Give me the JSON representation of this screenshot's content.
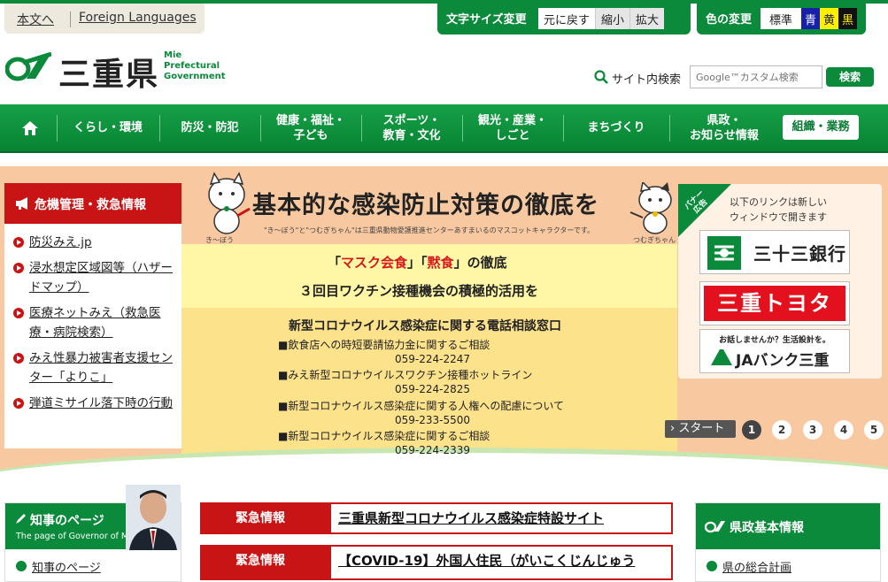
{
  "skip_links": {
    "main_text": "本文へ",
    "foreign": "Foreign Languages"
  },
  "font_size": {
    "label": "文字サイズ変更",
    "reset": "元に戻す",
    "smaller": "縮小",
    "larger": "拡大"
  },
  "color_change": {
    "label": "色の変更",
    "standard": "標準",
    "blue": "青",
    "yellow": "黄",
    "black": "黒"
  },
  "logo": {
    "kanji": "三重県",
    "en_line1": "Mie",
    "en_line2": "Prefectural",
    "en_line3": "Government"
  },
  "search": {
    "label": "サイト内検索",
    "placeholder": "Google™カスタム検索",
    "button": "検索"
  },
  "nav": {
    "home_icon": "home-icon",
    "items": [
      {
        "label": "くらし・環境"
      },
      {
        "label": "防災・防犯"
      },
      {
        "label": "健康・福祉・\n子ども"
      },
      {
        "label": "スポーツ・\n教育・文化"
      },
      {
        "label": "観光・産業・\nしごと"
      },
      {
        "label": "まちづくり"
      },
      {
        "label": "県政・\nお知らせ情報"
      }
    ],
    "special": "組織・業務"
  },
  "hero": {
    "title": "基本的な感染防止対策の徹底を",
    "note": "\"き～ぼう\"と\"つむぎちゃん\"は三重県動物愛護推進センターあすまいるのマスコットキャラクターです。",
    "char1": "き～ぼう",
    "char2": "つむぎちゃん",
    "line1_a": "「",
    "line1_red1": "マスク会食",
    "line1_b": "」「",
    "line1_red2": "黙食",
    "line1_c": "」の徹底",
    "line2": "３回目ワクチン接種機会の積極的活用を",
    "phone_title": "新型コロナウイルス感染症に関する電話相談窓口",
    "phones": [
      {
        "label": "■飲食店への時短要請協力金に関するご相談",
        "number": "059-224-2247"
      },
      {
        "label": "■みえ新型コロナウイルスワクチン接種ホットライン",
        "number": "059-224-2825"
      },
      {
        "label": "■新型コロナウイルス感染症に関する人権への配慮について",
        "number": "059-233-5500"
      },
      {
        "label": "■新型コロナウイルス感染症に関するご相談",
        "number": "059-224-2339"
      }
    ],
    "slider": {
      "start": "スタート",
      "pages": [
        "1",
        "2",
        "3",
        "4",
        "5"
      ],
      "active": "1"
    }
  },
  "crisis": {
    "title": "危機管理・救急情報",
    "items": [
      {
        "label": "防災みえ.jp"
      },
      {
        "label": "浸水想定区域図等（ハザードマップ）"
      },
      {
        "label": "医療ネットみえ（救急医療・病院検索）"
      },
      {
        "label": "みえ性暴力被害者支援センター「よりこ」"
      },
      {
        "label": "弾道ミサイル落下時の行動"
      }
    ]
  },
  "ads": {
    "corner": "バナー\n広告",
    "note_line1": "以下のリンクは新しい",
    "note_line2": "ウィンドウで開きます",
    "bank1": "三十三銀行",
    "toyota": "三重トヨタ",
    "ja_top": "お話しませんか？生活設計を。",
    "ja_name": "JAバンク三重"
  },
  "governor": {
    "title": "知事のページ",
    "subtitle": "The page of Governor of Mie",
    "link": "知事のページ"
  },
  "emergency": [
    {
      "tag": "緊急情報",
      "text": "三重県新型コロナウイルス感染症特設サイト"
    },
    {
      "tag": "緊急情報",
      "text": "【COVID-19】外国人住民（がいこくじんじゅう"
    }
  ],
  "basic_info": {
    "title": "県政基本情報",
    "link": "県の総合計画"
  },
  "colors": {
    "brand_green": "#0a8a3a",
    "alert_red": "#c81414"
  }
}
